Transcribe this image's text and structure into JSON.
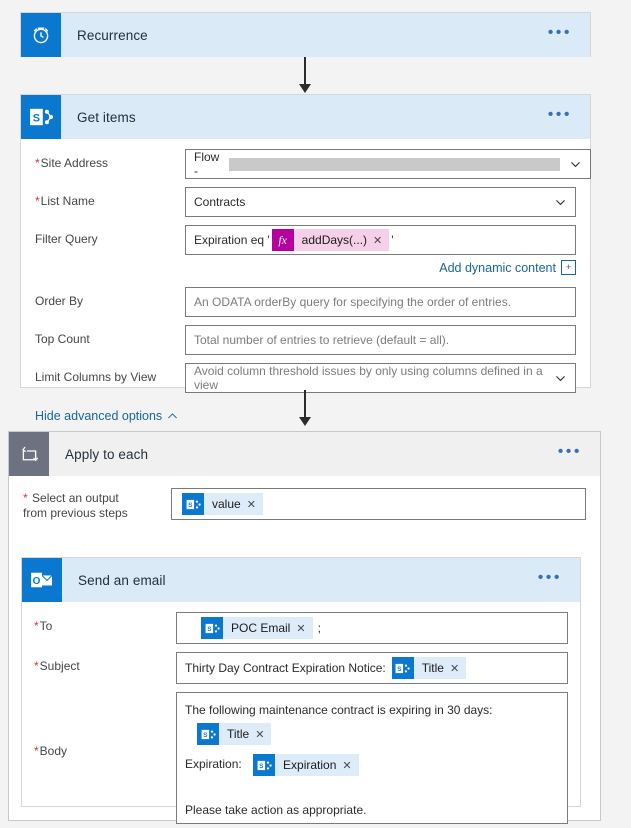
{
  "flow": {
    "steps": [
      {
        "id": "recurrence",
        "title": "Recurrence",
        "icon": "clock-icon",
        "menu": "•••"
      },
      {
        "id": "get-items",
        "title": "Get items",
        "icon": "sharepoint-icon",
        "menu": "•••",
        "fields": {
          "site_address": {
            "label": "Site Address",
            "required": true,
            "value_prefix": "Flow -",
            "redacted": true
          },
          "list_name": {
            "label": "List Name",
            "required": true,
            "value": "Contracts"
          },
          "filter_query": {
            "label": "Filter Query",
            "required": false,
            "text_before": "Expiration eq '",
            "token": {
              "icon_label": "fx",
              "label": "addDays(...)",
              "remove": "✕"
            },
            "text_after": "'"
          },
          "order_by": {
            "label": "Order By",
            "required": false,
            "placeholder": "An ODATA orderBy query for specifying the order of entries."
          },
          "top_count": {
            "label": "Top Count",
            "required": false,
            "placeholder": "Total number of entries to retrieve (default = all)."
          },
          "limit_columns": {
            "label": "Limit Columns by View",
            "required": false,
            "placeholder": "Avoid column threshold issues by only using columns defined in a view"
          }
        },
        "add_dynamic_content": "Add dynamic content",
        "add_dynamic_content_icon": "+",
        "hide_advanced_options": "Hide advanced options"
      },
      {
        "id": "apply-to-each",
        "title": "Apply to each",
        "icon": "loop-icon",
        "menu": "•••",
        "fields": {
          "select_output": {
            "label_line1": "Select an output",
            "label_line2": "from previous steps",
            "required": true,
            "token": {
              "icon": "sharepoint-icon",
              "label": "value",
              "remove": "✕"
            }
          }
        }
      },
      {
        "id": "send-an-email",
        "title": "Send an email",
        "icon": "outlook-icon",
        "menu": "•••",
        "fields": {
          "to": {
            "label": "To",
            "required": true,
            "token": {
              "icon": "sharepoint-icon",
              "label": "POC Email",
              "remove": "✕"
            },
            "text_after": ";"
          },
          "subject": {
            "label": "Subject",
            "required": true,
            "text_before": "Thirty Day Contract Expiration Notice:",
            "token": {
              "icon": "sharepoint-icon",
              "label": "Title",
              "remove": "✕"
            }
          },
          "body": {
            "label": "Body",
            "required": true,
            "line1": "The  following maintenance contract is expiring in 30 days:",
            "token1": {
              "icon": "sharepoint-icon",
              "label": "Title",
              "remove": "✕"
            },
            "line2_prefix": "Expiration:",
            "token2": {
              "icon": "sharepoint-icon",
              "label": "Expiration",
              "remove": "✕"
            },
            "line3": "Please take action as appropriate."
          }
        }
      }
    ]
  },
  "colors": {
    "accent_blue": "#0b78d0",
    "header_blue": "#dbeaf7",
    "header_gray": "#f0f0f0",
    "slate": "#6c7280",
    "token_blue": "#deecf9",
    "fx_magenta": "#b4009e",
    "required_red": "#d13438",
    "link_blue": "#18659e"
  }
}
